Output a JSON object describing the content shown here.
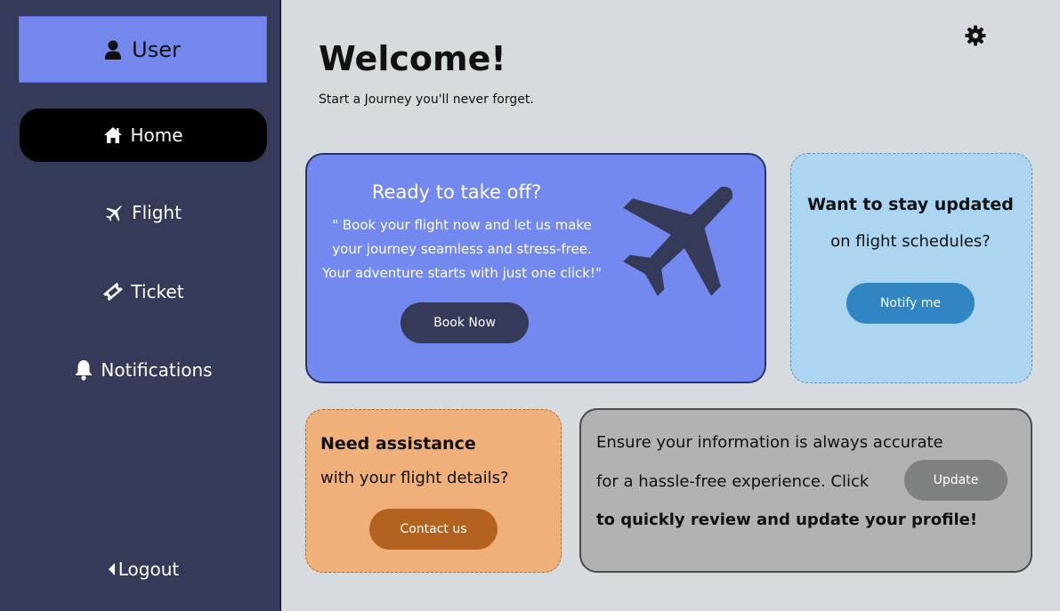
{
  "sidebar": {
    "user_label": "User",
    "nav": [
      {
        "label": "Home",
        "icon": "home-icon",
        "active": true
      },
      {
        "label": "Flight",
        "icon": "plane-icon"
      },
      {
        "label": "Ticket",
        "icon": "ticket-icon"
      },
      {
        "label": "Notifications",
        "icon": "bell-icon"
      }
    ],
    "logout_label": "Logout"
  },
  "header": {
    "title": "Welcome!",
    "subtitle": "Start a Journey you'll never forget."
  },
  "book_card": {
    "title": "Ready to take off?",
    "quote_line1": "\" Book your flight now and let us make",
    "quote_line2": "your journey seamless and stress-free.",
    "quote_line3": "Your adventure starts with just one click!\"",
    "button": "Book Now"
  },
  "notify_card": {
    "line1": "Want to stay updated",
    "line2": "on flight schedules?",
    "button": "Notify me"
  },
  "assist_card": {
    "line1": "Need assistance",
    "line2": "with your flight details?",
    "button": "Contact us"
  },
  "update_card": {
    "line1": "Ensure your information is always accurate",
    "line2": "for a hassle-free experience. Click",
    "line3": "to quickly review and update your profile!",
    "button": "Update"
  },
  "colors": {
    "sidebar": "#353a58",
    "accent_blue": "#7489ef",
    "light_blue": "#acd5f2",
    "orange": "#f0b07a",
    "gray_card": "#b1b3b3"
  }
}
